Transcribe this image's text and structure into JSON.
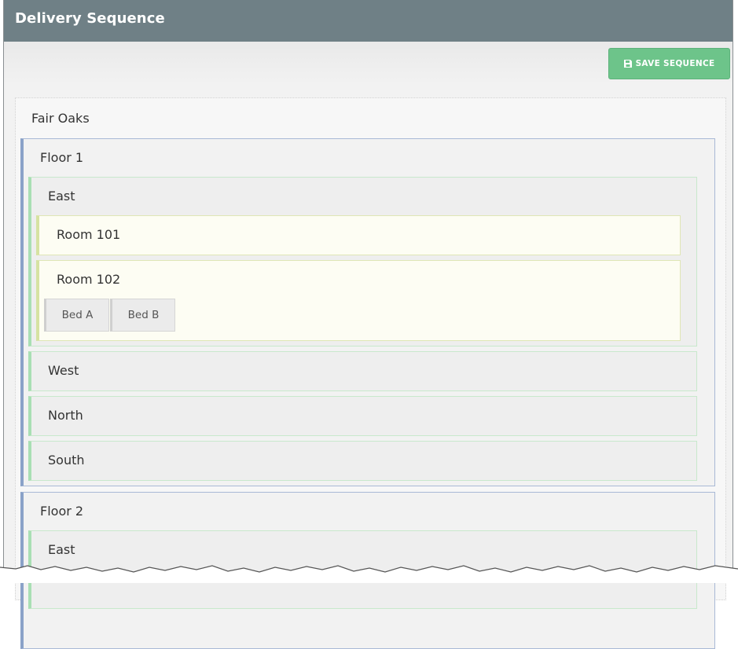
{
  "header": {
    "title": "Delivery Sequence"
  },
  "toolbar": {
    "save_label": "SAVE SEQUENCE",
    "save_icon": "floppy-disk-icon"
  },
  "colors": {
    "header_bg": "#6f8086",
    "save_button": "#6dc48a",
    "floor_accent": "#8aa2c8",
    "wing_accent": "#a9dfb3",
    "room_accent": "#d6e2a2"
  },
  "site": {
    "name": "Fair Oaks",
    "floors": [
      {
        "name": "Floor 1",
        "wings": [
          {
            "name": "East",
            "rooms": [
              {
                "name": "Room 101",
                "beds": []
              },
              {
                "name": "Room 102",
                "beds": [
                  "Bed A",
                  "Bed B"
                ]
              }
            ]
          },
          {
            "name": "West"
          },
          {
            "name": "North"
          },
          {
            "name": "South"
          }
        ]
      },
      {
        "name": "Floor 2",
        "wings": [
          {
            "name": "East"
          }
        ]
      }
    ]
  }
}
